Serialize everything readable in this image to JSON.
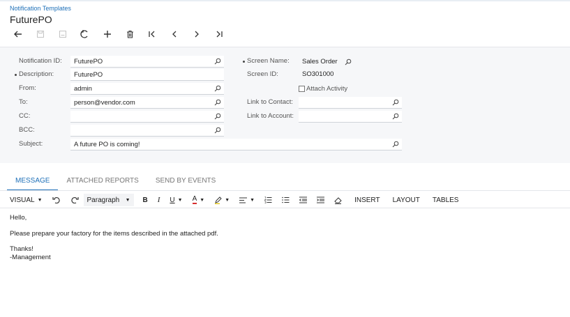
{
  "breadcrumb": "Notification Templates",
  "page_title": "FuturePO",
  "toolbar": {
    "buttons": [
      {
        "icon": "back-arrow-icon"
      },
      {
        "icon": "save-icon",
        "disabled": true
      },
      {
        "icon": "save-close-icon",
        "disabled": true
      },
      {
        "icon": "undo-icon"
      },
      {
        "icon": "add-icon"
      },
      {
        "icon": "delete-icon"
      },
      {
        "icon": "first-record-icon"
      },
      {
        "icon": "previous-record-icon"
      },
      {
        "icon": "next-record-icon"
      },
      {
        "icon": "last-record-icon"
      }
    ]
  },
  "form": {
    "notification_id": {
      "label": "Notification ID:",
      "value": "FuturePO"
    },
    "description": {
      "label": "Description:",
      "value": "FuturePO"
    },
    "from": {
      "label": "From:",
      "value": "admin"
    },
    "to": {
      "label": "To:",
      "value": "person@vendor.com"
    },
    "cc": {
      "label": "CC:",
      "value": ""
    },
    "bcc": {
      "label": "BCC:",
      "value": ""
    },
    "subject": {
      "label": "Subject:",
      "value": "A future PO is coming!"
    },
    "screen_name": {
      "label": "Screen Name:",
      "value": "Sales Order"
    },
    "screen_id": {
      "label": "Screen ID:",
      "value": "SO301000"
    },
    "attach_activity": {
      "label": "Attach Activity",
      "checked": false
    },
    "link_to_contact": {
      "label": "Link to Contact:",
      "value": ""
    },
    "link_to_account": {
      "label": "Link to Account:",
      "value": ""
    }
  },
  "tabs": [
    {
      "label": "MESSAGE",
      "active": true
    },
    {
      "label": "ATTACHED REPORTS",
      "active": false
    },
    {
      "label": "SEND BY EVENTS",
      "active": false
    }
  ],
  "editor_toolbar": {
    "mode": "VISUAL",
    "paragraph": "Paragraph",
    "bold": "B",
    "italic": "I",
    "underline": "U",
    "font_color": "A",
    "insert": "INSERT",
    "layout": "LAYOUT",
    "tables": "TABLES"
  },
  "message": {
    "line1": "Hello,",
    "line2": "Please prepare your factory for the items described in the attached pdf.",
    "line3": "Thanks!",
    "line4": "-Management"
  },
  "colors": {
    "accent": "#1d6fb8",
    "form_background": "#f6f7f9"
  }
}
